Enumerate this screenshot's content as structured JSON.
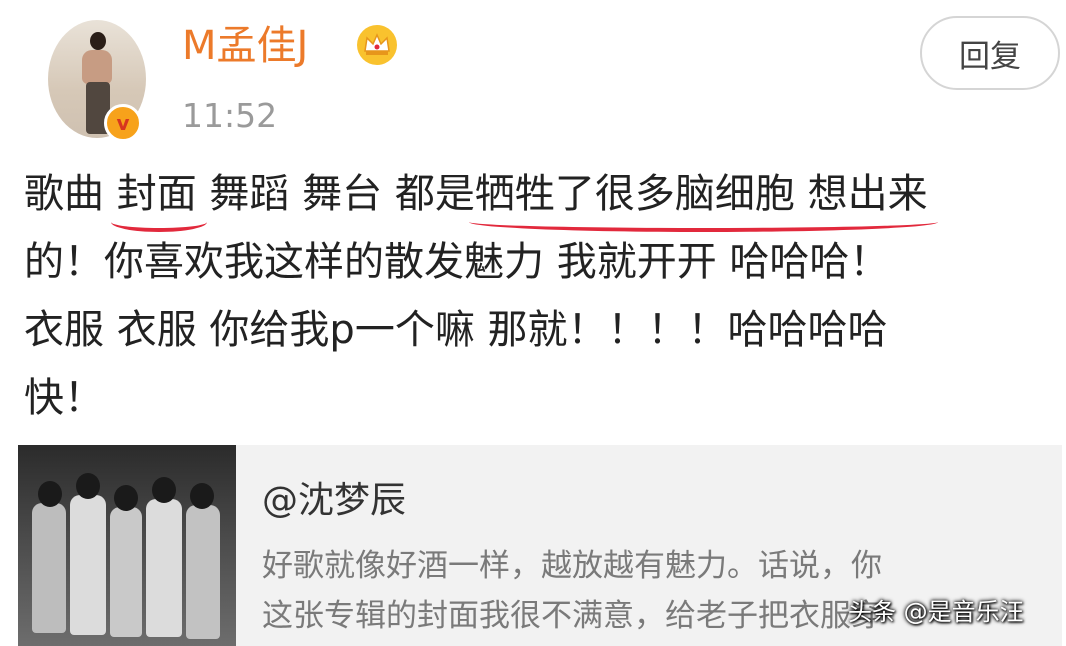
{
  "post": {
    "username": "M孟佳J",
    "time": "11:52",
    "reply_label": "回复",
    "lines": [
      [
        "歌曲 ",
        "封面",
        " 舞蹈 舞台 都是",
        "牺牲了很多脑细胞 想出来"
      ],
      [
        "的！你喜欢我这样的散发魅力 我就开开 哈哈哈！"
      ],
      [
        "衣服 衣服 你给我p一个嘛 那就！！！！哈哈哈哈"
      ],
      [
        "快！"
      ]
    ]
  },
  "quote": {
    "author": "@沈梦辰",
    "text_line1": "好歌就像好酒一样，越放越有魅力。话说，你",
    "text_line2": "这张专辑的封面我很不满意，给老子把衣服穿"
  },
  "watermark": "头条 @是音乐汪",
  "colors": {
    "username": "#ec7a2a",
    "underline": "#e2293c",
    "badge": "#f7a21b",
    "quote_bg": "#f2f2f2"
  }
}
